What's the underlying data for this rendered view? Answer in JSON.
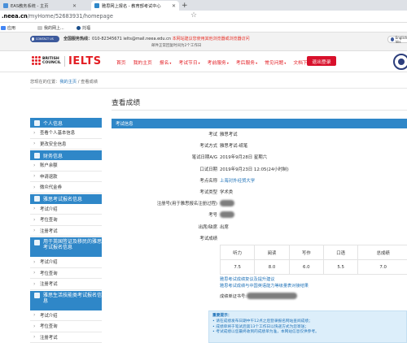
{
  "browser": {
    "tabs": [
      {
        "label": "EAS教务系统 - 主页"
      },
      {
        "label": "雅思网上报名 - 教育部考试中心"
      }
    ],
    "new_tab": "+",
    "url_host": ".neea.cn",
    "url_path": "/myHome/52683931/homepage",
    "bookmarks": [
      {
        "label": "应用"
      },
      {
        "label": "我的网上..."
      },
      {
        "label": "托福"
      }
    ]
  },
  "site_top": {
    "contact_label": "CONTACT US",
    "hotline_label": "全国服务热线：",
    "hotline": "010-82345671 ielts@mail.neea.edu.cn",
    "notice": "本网站建议您使用其他浏览器或浏览器访问",
    "hours": "邮件正常回复时间为2个工作日",
    "english": "English Ver."
  },
  "header": {
    "brand_line1": "BRITISH",
    "brand_line2": "COUNCIL",
    "ielts": "IELTS",
    "nav": [
      "首页",
      "我的主页",
      "报名",
      "考试节日",
      "考前服务",
      "考后服务",
      "常见问题",
      "文档下载"
    ],
    "nav_with_caret": [
      false,
      false,
      true,
      true,
      true,
      true,
      true,
      false
    ],
    "logout": "退出登录"
  },
  "breadcrumb": {
    "prefix": "您现在的位置：",
    "home": "我的主页",
    "sep": " / ",
    "current": "查看成绩"
  },
  "sidebar": {
    "sections": [
      {
        "title": "个人信息",
        "items": [
          "查看个人基本信息",
          "更改安全信息"
        ]
      },
      {
        "title": "财务信息",
        "items": [
          "账户余额",
          "申请退款",
          "微众代金券"
        ]
      },
      {
        "title": "雅思考试报名信息",
        "items": [
          "考试介绍",
          "考位查询",
          "注册考试"
        ]
      },
      {
        "title": "用于英国签证及移民的雅思考试报名信息",
        "items": [
          "考试介绍",
          "考位查询",
          "注册考试"
        ]
      },
      {
        "title": "雅思生活技能类考试报名信息",
        "items": [
          "考试介绍",
          "考位查询",
          "注册考试"
        ]
      }
    ]
  },
  "main": {
    "title": "查看成绩",
    "section": "考试信息",
    "rows": [
      {
        "k": "考试",
        "v": "雅思考试"
      },
      {
        "k": "考试方式",
        "v": "雅思考试-纸笔"
      },
      {
        "k": "笔试日期A/G",
        "v": "2019年9月28日 星期六"
      },
      {
        "k": "口试日期",
        "v": "2019年9月23日 12:05(24小时制)"
      },
      {
        "k": "考点名称",
        "v": "上海对外经贸大学"
      },
      {
        "k": "考试类型",
        "v": "学术类"
      },
      {
        "k": "注册号(用于雅思报名注册过程)",
        "v": ""
      },
      {
        "k": "考号",
        "v": ""
      },
      {
        "k": "出席/缺席",
        "v": "出席"
      },
      {
        "k": "考试成绩",
        "v": ""
      }
    ],
    "score_headers": [
      "听力",
      "阅读",
      "写作",
      "口语",
      "总成绩"
    ],
    "scores": [
      "7.5",
      "8.0",
      "6.0",
      "5.5",
      "7.0"
    ],
    "links": [
      "雅思考试成绩复议及提升建议",
      "雅思考试成绩与中国英语能力等级量表对接结果"
    ],
    "written_label": "成绩单证书号:",
    "notice_title": "重要提示：",
    "notices": [
      "• 请在成绩发布日期中午12点之后登录报名网站查阅成绩；",
      "• 成绩单将于笔试后第13个工作日以快递方式为您寄送；",
      "• 考试成绩以您最终收到的成绩单为准，本网站信息仅供参考。"
    ]
  },
  "colors": {
    "accent_blue": "#2f87c8",
    "brand_red": "#e31e24",
    "logout_red": "#d8102b",
    "link_blue": "#1f72b8"
  }
}
